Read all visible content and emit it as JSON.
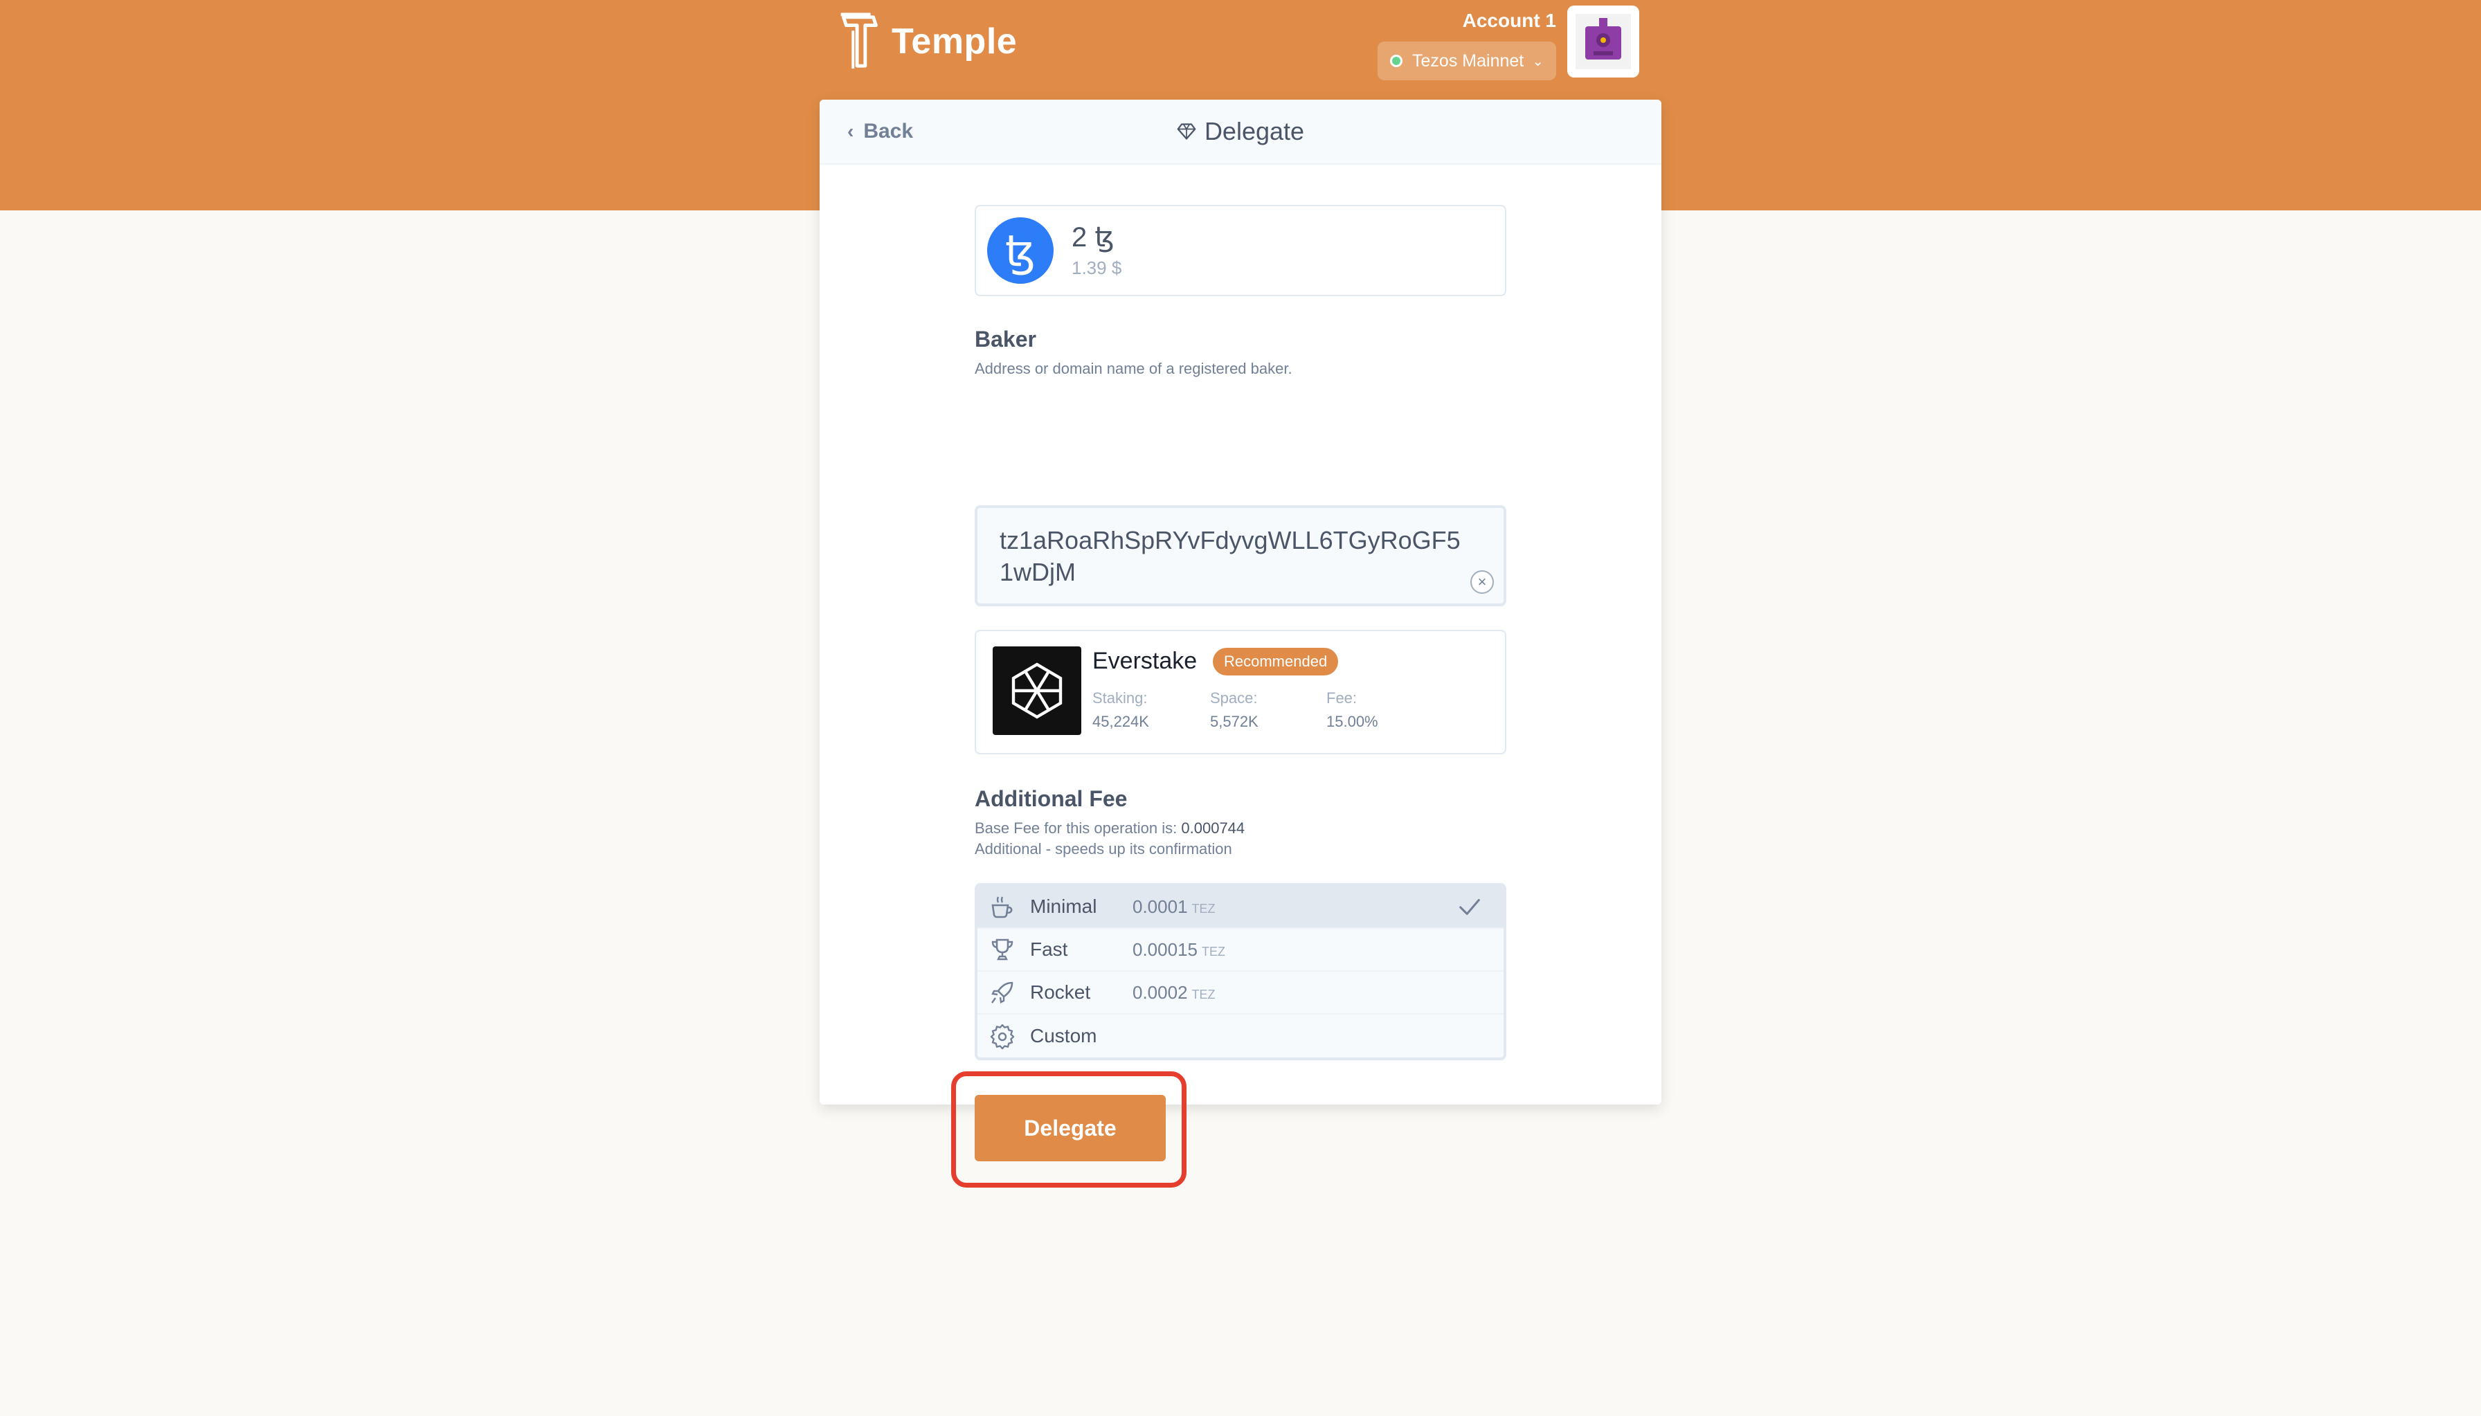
{
  "app": {
    "name": "Temple"
  },
  "account": {
    "label": "Account 1",
    "network": "Tezos Mainnet"
  },
  "header": {
    "back_label": "Back",
    "title": "Delegate"
  },
  "asset": {
    "amount": "2 ꜩ",
    "usd_value": "1.39 $"
  },
  "baker": {
    "title": "Baker",
    "description": "Address or domain name of a registered baker.",
    "input_value": "tz1aRoaRhSpRYvFdyvgWLL6TGyRoGF51wDjM"
  },
  "baker_info": {
    "name": "Everstake",
    "badge": "Recommended",
    "stats": [
      {
        "label": "Staking:",
        "value": "45,224K"
      },
      {
        "label": "Space:",
        "value": "5,572K"
      },
      {
        "label": "Fee:",
        "value": "15.00%"
      }
    ]
  },
  "additional_fee": {
    "title": "Additional Fee",
    "base_fee_prefix": "Base Fee for this operation is:",
    "base_fee_value": "0.000744",
    "additional_text": "Additional - speeds up its confirmation",
    "options": [
      {
        "name": "Minimal",
        "amount": "0.0001",
        "unit": "TEZ",
        "icon": "coffee-icon",
        "selected": true
      },
      {
        "name": "Fast",
        "amount": "0.00015",
        "unit": "TEZ",
        "icon": "trophy-icon",
        "selected": false
      },
      {
        "name": "Rocket",
        "amount": "0.0002",
        "unit": "TEZ",
        "icon": "rocket-icon",
        "selected": false
      },
      {
        "name": "Custom",
        "amount": "",
        "unit": "",
        "icon": "gear-icon",
        "selected": false
      }
    ]
  },
  "actions": {
    "delegate_label": "Delegate"
  },
  "colors": {
    "brand": "#e08c48",
    "tez_blue": "#2c7df7",
    "highlight": "#e53e2e"
  }
}
